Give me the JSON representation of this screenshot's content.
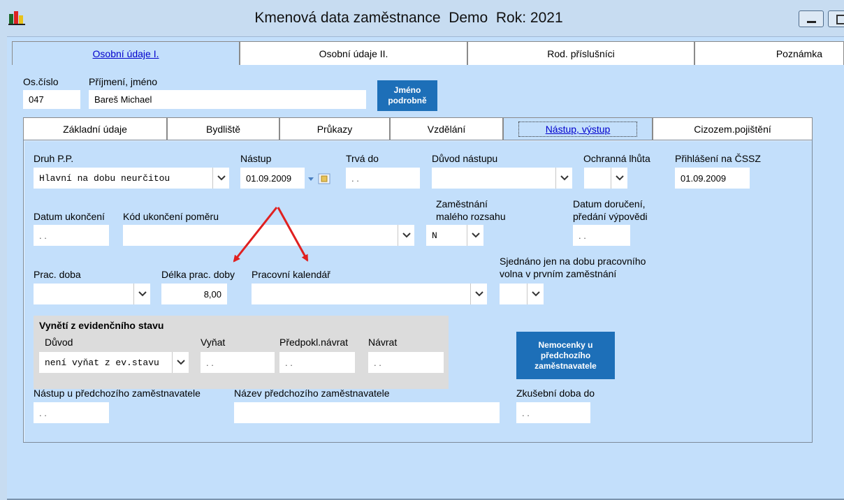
{
  "window": {
    "title": "Kmenová data zaměstnance  Demo  Rok: 2021"
  },
  "top_tabs": [
    {
      "label": "Osobní údaje I.",
      "active": true
    },
    {
      "label": "Osobní údaje II.",
      "active": false
    },
    {
      "label": "Rod. příslušníci",
      "active": false
    },
    {
      "label": "Poznámka",
      "active": false
    }
  ],
  "header": {
    "os_cislo_label": "Os.číslo",
    "os_cislo_value": "047",
    "jmeno_label": "Příjmení, jméno",
    "jmeno_value": "Bareš Michael",
    "jmeno_button": "Jméno podrobně"
  },
  "inner_tabs": [
    {
      "label": "Základní údaje",
      "active": false
    },
    {
      "label": "Bydliště",
      "active": false
    },
    {
      "label": "Průkazy",
      "active": false
    },
    {
      "label": "Vzdělání",
      "active": false
    },
    {
      "label": "Nástup, výstup",
      "active": true
    },
    {
      "label": "Cizozem.pojištění",
      "active": false
    }
  ],
  "form": {
    "druh_pp": {
      "label": "Druh P.P.",
      "value": "Hlavní na dobu neurčitou"
    },
    "nastup": {
      "label": "Nástup",
      "value": "01.09.2009"
    },
    "trva_do": {
      "label": "Trvá do",
      "value": ". ."
    },
    "duvod_nastupu": {
      "label": "Důvod nástupu",
      "value": ""
    },
    "ochranna_lhuta": {
      "label": "Ochranná lhůta",
      "value": ""
    },
    "prihlaseni_cssz": {
      "label": "Přihlášení na ČSSZ",
      "value": "01.09.2009"
    },
    "datum_ukonceni": {
      "label": "Datum ukončení",
      "value": ". ."
    },
    "kod_ukonceni": {
      "label": "Kód ukončení poměru",
      "value": ""
    },
    "zamestnani_maleho": {
      "label_line1": "Zaměstnání",
      "label_line2": "malého rozsahu",
      "value": "N"
    },
    "datum_doruceni": {
      "label_line1": "Datum doručení,",
      "label_line2": "předání výpovědi",
      "value": ". ."
    },
    "prac_doba": {
      "label": "Prac. doba",
      "value": ""
    },
    "delka_prac_doby": {
      "label": "Délka prac. doby",
      "value": "8,00"
    },
    "pracovni_kalendar": {
      "label": "Pracovní kalendář",
      "value": ""
    },
    "sjednano": {
      "label_line1": "Sjednáno jen na dobu pracovního",
      "label_line2": "volna v prvním zaměstnání",
      "value": ""
    },
    "vynet": {
      "title": "Vynětí z evidenčního stavu",
      "duvod_label": "Důvod",
      "duvod_value": "není vyňat z ev.stavu",
      "vynat_label": "Vyňat",
      "vynat_value": ". .",
      "predpokl_label": "Předpokl.návrat",
      "predpokl_value": ". .",
      "navrat_label": "Návrat",
      "navrat_value": ". ."
    },
    "nemocenky_button": "Nemocenky u předchozího zaměstnavatele",
    "nastup_predchozi": {
      "label": "Nástup u předchozího zaměstnavatele",
      "value": ". ."
    },
    "nazev_predchoziho": {
      "label": "Název předchozího zaměstnavatele",
      "value": ""
    },
    "zkusebni_doba": {
      "label": "Zkušební doba do",
      "value": ". ."
    }
  },
  "colors": {
    "panel": "#c3dffb",
    "button": "#1d6fb8",
    "annotation_arrow": "#e02020",
    "link": "#0000cc"
  }
}
